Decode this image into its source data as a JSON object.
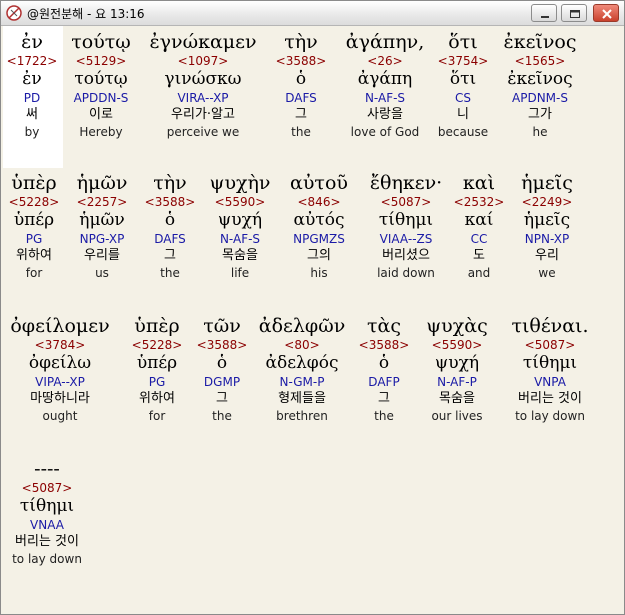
{
  "window": {
    "title": "@원전분해 - 요 13:16",
    "icon": "bible-icon",
    "buttons": [
      "minimize",
      "maximize",
      "close"
    ]
  },
  "rows": [
    [
      {
        "greek": "ἐν",
        "strong": "<1722>",
        "lemma": "ἐν",
        "parse": "PD",
        "korean": "써",
        "english": "by"
      },
      {
        "greek": "τούτῳ",
        "strong": "<5129>",
        "lemma": "τούτῳ",
        "parse": "APDDN-S",
        "korean": "이로",
        "english": "Hereby"
      },
      {
        "greek": "ἐγνώκαμεν",
        "strong": "<1097>",
        "lemma": "γινώσκω",
        "parse": "VIRA--XP",
        "korean": "우리가·알고",
        "english": "perceive we"
      },
      {
        "greek": "τὴν",
        "strong": "<3588>",
        "lemma": "ὁ",
        "parse": "DAFS",
        "korean": "그",
        "english": "the"
      },
      {
        "greek": "ἀγάπην,",
        "strong": "<26>",
        "lemma": "ἀγάπη",
        "parse": "N-AF-S",
        "korean": "사랑을",
        "english": "love of God"
      },
      {
        "greek": "ὅτι",
        "strong": "<3754>",
        "lemma": "ὅτι",
        "parse": "CS",
        "korean": "니",
        "english": "because"
      },
      {
        "greek": "ἐκεῖνος",
        "strong": "<1565>",
        "lemma": "ἐκεῖνος",
        "parse": "APDNM-S",
        "korean": "그가",
        "english": "he"
      }
    ],
    [
      {
        "greek": "ὑπὲρ",
        "strong": "<5228>",
        "lemma": "ὑπέρ",
        "parse": "PG",
        "korean": "위하여",
        "english": "for"
      },
      {
        "greek": "ἡμῶν",
        "strong": "<2257>",
        "lemma": "ἡμῶν",
        "parse": "NPG-XP",
        "korean": "우리를",
        "english": "us"
      },
      {
        "greek": "τὴν",
        "strong": "<3588>",
        "lemma": "ὁ",
        "parse": "DAFS",
        "korean": "그",
        "english": "the"
      },
      {
        "greek": "ψυχὴν",
        "strong": "<5590>",
        "lemma": "ψυχή",
        "parse": "N-AF-S",
        "korean": "목숨을",
        "english": "life"
      },
      {
        "greek": "αὐτοῦ",
        "strong": "<846>",
        "lemma": "αὐτός",
        "parse": "NPGMZS",
        "korean": "그의",
        "english": "his"
      },
      {
        "greek": "ἔθηκεν·",
        "strong": "<5087>",
        "lemma": "τίθημι",
        "parse": "VIAA--ZS",
        "korean": "버리셨으",
        "english": "laid down"
      },
      {
        "greek": "καὶ",
        "strong": "<2532>",
        "lemma": "καί",
        "parse": "CC",
        "korean": "도",
        "english": "and"
      },
      {
        "greek": "ἡμεῖς",
        "strong": "<2249>",
        "lemma": "ἡμεῖς",
        "parse": "NPN-XP",
        "korean": "우리",
        "english": "we"
      }
    ],
    [
      {
        "greek": "ὀφείλομεν",
        "strong": "<3784>",
        "lemma": "ὀφείλω",
        "parse": "VIPA--XP",
        "korean": "마땅하니라",
        "english": "ought"
      },
      {
        "greek": "ὑπὲρ",
        "strong": "<5228>",
        "lemma": "ὑπέρ",
        "parse": "PG",
        "korean": "위하여",
        "english": "for"
      },
      {
        "greek": "τῶν",
        "strong": "<3588>",
        "lemma": "ὁ",
        "parse": "DGMP",
        "korean": "그",
        "english": "the"
      },
      {
        "greek": "ἀδελφῶν",
        "strong": "<80>",
        "lemma": "ἀδελφός",
        "parse": "N-GM-P",
        "korean": "형제들을",
        "english": "brethren"
      },
      {
        "greek": "τὰς",
        "strong": "<3588>",
        "lemma": "ὁ",
        "parse": "DAFP",
        "korean": "그",
        "english": "the"
      },
      {
        "greek": "ψυχὰς",
        "strong": "<5590>",
        "lemma": "ψυχή",
        "parse": "N-AF-P",
        "korean": "목숨을",
        "english": "our lives"
      },
      {
        "greek": "τιθέναι.",
        "strong": "<5087>",
        "lemma": "τίθημι",
        "parse": "VNPA",
        "korean": "버리는 것이",
        "english": "to lay down"
      }
    ],
    [
      {
        "greek": "----",
        "strong": "<5087>",
        "lemma": "τίθημι",
        "parse": "VNAA",
        "korean": "버리는 것이",
        "english": "to lay down"
      }
    ]
  ]
}
